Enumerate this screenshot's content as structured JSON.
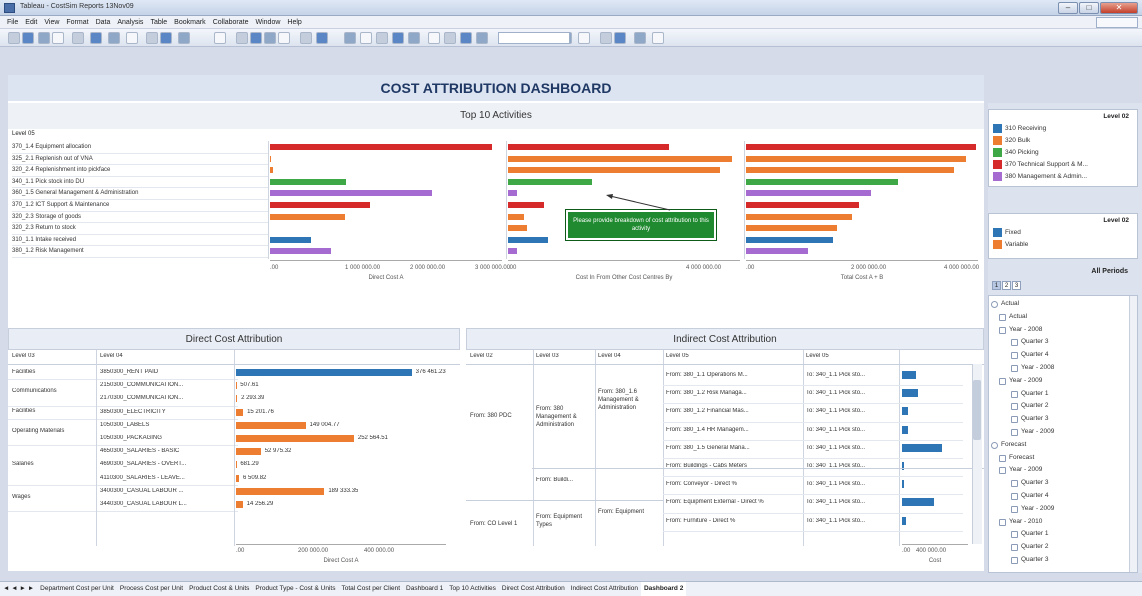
{
  "window": {
    "title": "Tableau - CostSim Reports 13Nov09"
  },
  "menu": [
    "File",
    "Edit",
    "View",
    "Format",
    "Data",
    "Analysis",
    "Table",
    "Bookmark",
    "Collaborate",
    "Window",
    "Help"
  ],
  "dashboard": {
    "title": "COST ATTRIBUTION DASHBOARD"
  },
  "top10": {
    "title": "Top 10 Activities",
    "col_header": "Level 05",
    "rows": [
      "370_1.4 Equipment allocation",
      "325_2.1 Replenish out of VNA",
      "320_2.4 Replenishment into pickface",
      "340_1.1 Pick stock into DU",
      "360_1.5 General Management & Administration",
      "370_1.2 ICT Support & Maintenance",
      "320_2.3 Storage of goods",
      "320_2.3 Return to stock",
      "310_1.1 Intake received",
      "380_1.2 Risk Management"
    ],
    "axis1": {
      "ticks": [
        ".00",
        "1 000 000.00",
        "2 000 000.00",
        "3 000 000.00"
      ],
      "label": "Direct Cost A"
    },
    "axis2": {
      "ticks": [
        ".00",
        "4 000 000.00"
      ],
      "label": "Cost In From Other Cost Centres By"
    },
    "axis3": {
      "ticks": [
        ".00",
        "2 000 000.00",
        "4 000 000.00"
      ],
      "label": "Total Cost A + B"
    },
    "tooltip": "Please provide breakdown of cost attribution to this activity"
  },
  "chart_data": [
    {
      "type": "bar",
      "title": "Top 10 Activities",
      "xlabel": "Direct Cost A",
      "categories": [
        "370_1.4 Equipment allocation",
        "325_2.1 Replenish out of VNA",
        "320_2.4 Replenishment into pickface",
        "340_1.1 Pick stock into DU",
        "360_1.5 General Management & Administration",
        "370_1.2 ICT Support & Maintenance",
        "320_2.3 Storage of goods",
        "320_2.3 Return to stock",
        "310_1.1 Intake received",
        "380_1.2 Risk Management"
      ],
      "values": [
        2970000,
        20000,
        40000,
        1020000,
        2160000,
        1340000,
        1000000,
        0,
        550000,
        820000
      ],
      "xlim": [
        0,
        3100000
      ]
    },
    {
      "type": "bar",
      "xlabel": "Cost In From Other Cost Centres By",
      "categories": [
        "370_1.4 Equipment allocation",
        "325_2.1 Replenish out of VNA",
        "320_2.4 Replenishment into pickface",
        "340_1.1 Pick stock into DU",
        "360_1.5 General Management & Administration",
        "370_1.2 ICT Support & Maintenance",
        "320_2.3 Storage of goods",
        "320_2.3 Return to stock",
        "310_1.1 Intake received",
        "380_1.2 Risk Management"
      ],
      "values": [
        3470000,
        4820000,
        4560000,
        1810000,
        200000,
        780000,
        340000,
        400000,
        860000,
        200000
      ],
      "xlim": [
        0,
        5000000
      ]
    },
    {
      "type": "bar",
      "xlabel": "Total Cost A + B",
      "categories": [
        "370_1.4 Equipment allocation",
        "325_2.1 Replenish out of VNA",
        "320_2.4 Replenishment into pickface",
        "340_1.1 Pick stock into DU",
        "360_1.5 General Management & Administration",
        "370_1.2 ICT Support & Maintenance",
        "320_2.3 Storage of goods",
        "320_2.3 Return to stock",
        "310_1.1 Intake received",
        "380_1.2 Risk Management"
      ],
      "values": [
        5350000,
        5120000,
        4830000,
        3540000,
        2920000,
        2620000,
        2460000,
        2110000,
        2020000,
        1450000
      ],
      "xlim": [
        0,
        5400000
      ]
    },
    {
      "type": "bar",
      "title": "Direct Cost Attribution",
      "xlabel": "Direct Cost A",
      "categories": [
        "3850300_RENT PAID",
        "2150300_COMMUNICATION...",
        "2170300_COMMUNICATION...",
        "3850300_ELECTRICITY",
        "1050300_LABELS",
        "1050300_PACKAGING",
        "4650300_SALARIES - BASIC",
        "4690300_SALARIES - OVERT...",
        "4110300_SALARIES - LEAVE...",
        "3400300_CASUAL LABOUR ...",
        "3440300_CASUAL LABOUR L..."
      ],
      "values": [
        376461.23,
        507.61,
        2293.39,
        15201.76,
        149004.77,
        252564.51,
        52975.32,
        681.29,
        6509.82,
        189333.35,
        14256.29
      ],
      "xlim": [
        0,
        450000
      ]
    }
  ],
  "direct": {
    "title": "Direct Cost Attribution",
    "headers": [
      "Level 03",
      "Level 04"
    ],
    "groups": [
      {
        "name": "Facilities",
        "rows": 1
      },
      {
        "name": "Communications",
        "rows": 2
      },
      {
        "name": "Facilities",
        "rows": 1
      },
      {
        "name": "Operating Materials",
        "rows": 2
      },
      {
        "name": "Salaries",
        "rows": 3
      },
      {
        "name": "Wages",
        "rows": 2
      }
    ],
    "rows": [
      {
        "l4": "3850300_RENT PAID",
        "value": "376 461.23",
        "color": "#2e75b6"
      },
      {
        "l4": "2150300_COMMUNICATION...",
        "value": "507.61",
        "color": "#ed7d31"
      },
      {
        "l4": "2170300_COMMUNICATION...",
        "value": "2 293.39",
        "color": "#ed7d31"
      },
      {
        "l4": "3850300_ELECTRICITY",
        "value": "15 201.76",
        "color": "#ed7d31"
      },
      {
        "l4": "1050300_LABELS",
        "value": "149 004.77",
        "color": "#ed7d31"
      },
      {
        "l4": "1050300_PACKAGING",
        "value": "252 564.51",
        "color": "#ed7d31"
      },
      {
        "l4": "4650300_SALARIES - BASIC",
        "value": "52 975.32",
        "color": "#ed7d31"
      },
      {
        "l4": "4690300_SALARIES - OVERT...",
        "value": "681.29",
        "color": "#ed7d31"
      },
      {
        "l4": "4110300_SALARIES - LEAVE...",
        "value": "6 509.82",
        "color": "#ed7d31"
      },
      {
        "l4": "3400300_CASUAL LABOUR ...",
        "value": "189 333.35",
        "color": "#ed7d31"
      },
      {
        "l4": "3440300_CASUAL LABOUR L...",
        "value": "14 256.29",
        "color": "#ed7d31"
      }
    ],
    "axis": {
      "ticks": [
        ".00",
        "200 000.00",
        "400 000.00"
      ],
      "label": "Direct Cost A"
    }
  },
  "indirect": {
    "title": "Indirect Cost Attribution",
    "headers": [
      "Level 02",
      "Level 03",
      "Level 04",
      "Level 05",
      "Level 05"
    ],
    "l2": [
      "From: 380 PDC",
      "From: CO Level 1"
    ],
    "l3": [
      "From: 380 Management & Administration",
      "From: Buildi...",
      "From: Equipment Types"
    ],
    "l4": [
      "From: 380_1.6 Management & Administration",
      "From: Equipment"
    ],
    "rows": [
      {
        "l5a": "From: 380_1.1 Operations M...",
        "l5b": "To: 340_1.1 Pick sto...",
        "v": 0.035
      },
      {
        "l5a": "From: 380_1.2 Risk Managa...",
        "l5b": "To: 340_1.1 Pick sto...",
        "v": 0.04
      },
      {
        "l5a": "From: 380_1.2 Financial Mas...",
        "l5b": "To: 340_1.1 Pick sto...",
        "v": 0.015
      },
      {
        "l5a": "From: 380_1.4 HR Managem...",
        "l5b": "To: 340_1.1 Pick sto...",
        "v": 0.015
      },
      {
        "l5a": "From: 380_1.5 General Mana...",
        "l5b": "To: 340_1.1 Pick sto...",
        "v": 0.1
      },
      {
        "l5a": "From: Buildings - Cabs Meters",
        "l5b": "To: 340_1.1 Pick sto...",
        "v": 0.005
      },
      {
        "l5a": "From: Conveyor - Direct %",
        "l5b": "To: 340_1.1 Pick sto...",
        "v": 0.005
      },
      {
        "l5a": "From: Equipment External - Direct %",
        "l5b": "To: 340_1.1 Pick sto...",
        "v": 0.08
      },
      {
        "l5a": "From: Furniture - Direct %",
        "l5b": "To: 340_1.1 Pick sto...",
        "v": 0.01
      }
    ],
    "axis": {
      "ticks": [
        ".00",
        "400 000.00"
      ],
      "label": "Cost"
    }
  },
  "legend1": {
    "title": "Level 02",
    "items": [
      {
        "label": "310 Receiving",
        "color": "#2e75b6"
      },
      {
        "label": "320 Bulk",
        "color": "#ed7d31"
      },
      {
        "label": "340 Picking",
        "color": "#3ea846"
      },
      {
        "label": "370 Technical Support & M...",
        "color": "#d62a2a"
      },
      {
        "label": "380 Management & Admin...",
        "color": "#a66bd1"
      }
    ]
  },
  "legend2": {
    "title": "Level 02",
    "items": [
      {
        "label": "Fixed",
        "color": "#2e75b6"
      },
      {
        "label": "Variable",
        "color": "#ed7d31"
      }
    ]
  },
  "periods": {
    "title": "All Periods",
    "tabs": [
      "1",
      "2",
      "3"
    ],
    "tree": [
      "Actual",
      "Actual",
      "Year - 2008",
      "Quarter 3",
      "Quarter 4",
      "Year - 2008",
      "Year - 2009",
      "Quarter 1",
      "Quarter 2",
      "Quarter 3",
      "Year - 2009",
      "Forecast",
      "Forecast",
      "Year - 2009",
      "Quarter 3",
      "Quarter 4",
      "Year - 2009",
      "Year - 2010",
      "Quarter 1",
      "Quarter 2",
      "Quarter 3"
    ]
  },
  "tabs": [
    "Department Cost per Unit",
    "Process Cost per Unit",
    "Product Cost & Units",
    "Product Type - Cost & Units",
    "Total Cost per Client",
    "Dashboard 1",
    "Top 10 Activities",
    "Direct Cost Attribution",
    "Indirect Cost Attribution",
    "Dashboard 2"
  ],
  "active_tab": "Dashboard 2"
}
